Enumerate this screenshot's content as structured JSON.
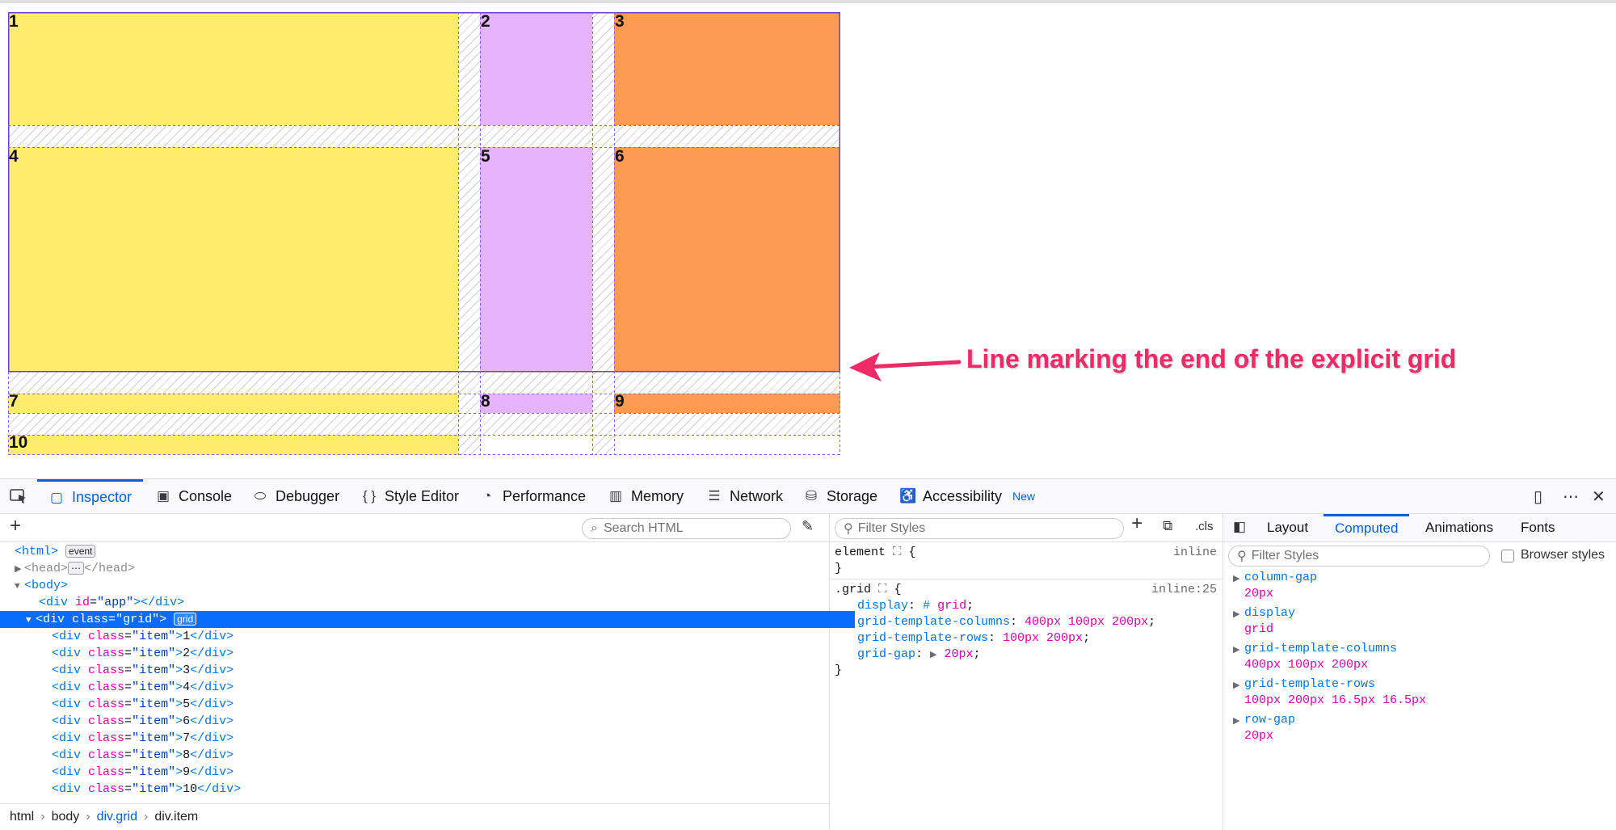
{
  "grid_items": [
    "1",
    "2",
    "3",
    "4",
    "5",
    "6",
    "7",
    "8",
    "9",
    "10"
  ],
  "annotation": "Line marking the end of the explicit grid",
  "toolbar": {
    "tabs": [
      {
        "label": "Inspector",
        "icon": "inspector-icon"
      },
      {
        "label": "Console",
        "icon": "console-icon"
      },
      {
        "label": "Debugger",
        "icon": "debugger-icon"
      },
      {
        "label": "Style Editor",
        "icon": "style-editor-icon"
      },
      {
        "label": "Performance",
        "icon": "performance-icon"
      },
      {
        "label": "Memory",
        "icon": "memory-icon"
      },
      {
        "label": "Network",
        "icon": "network-icon"
      },
      {
        "label": "Storage",
        "icon": "storage-icon"
      },
      {
        "label": "Accessibility",
        "icon": "accessibility-icon"
      }
    ],
    "new_badge": "New"
  },
  "markup": {
    "search_placeholder": "Search HTML",
    "html_open": "<html>",
    "event_badge": "event",
    "head_open": "<head>",
    "head_ellipsis": "⋯",
    "head_close": "</head>",
    "body_open": "<body>",
    "app_div": {
      "tag": "<div",
      "attr": "id",
      "val": "\"app\"",
      "end": "></div>"
    },
    "grid_div": {
      "tag": "<div",
      "attr": "class",
      "val": "\"grid\"",
      "end": ">"
    },
    "grid_badge": "grid",
    "items": [
      {
        "text": "1"
      },
      {
        "text": "2"
      },
      {
        "text": "3"
      },
      {
        "text": "4"
      },
      {
        "text": "5"
      },
      {
        "text": "6"
      },
      {
        "text": "7"
      },
      {
        "text": "8"
      },
      {
        "text": "9"
      },
      {
        "text": "10"
      }
    ],
    "item_tag": "<div",
    "item_attr": "class",
    "item_val": "\"item\"",
    "item_gt": ">",
    "item_close": "</div>"
  },
  "breadcrumbs": [
    "html",
    "body",
    "div.grid",
    "div.item"
  ],
  "rules": {
    "filter_placeholder": "Filter Styles",
    "cls_label": ".cls",
    "element_selector": "element",
    "element_source": "inline",
    "grid_selector": ".grid",
    "grid_source": "inline:25",
    "declarations": [
      {
        "prop": "display",
        "value": "grid"
      },
      {
        "prop": "grid-template-columns",
        "value": "400px 100px 200px"
      },
      {
        "prop": "grid-template-rows",
        "value": "100px 200px"
      },
      {
        "prop": "grid-gap",
        "value": "20px"
      }
    ]
  },
  "sidebar": {
    "tabs": [
      "Layout",
      "Computed",
      "Animations",
      "Fonts"
    ],
    "active_tab": "Computed",
    "filter_placeholder": "Filter Styles",
    "browser_styles_label": "Browser styles",
    "computed": [
      {
        "name": "column-gap",
        "value": "20px"
      },
      {
        "name": "display",
        "value": "grid"
      },
      {
        "name": "grid-template-columns",
        "value": "400px 100px 200px"
      },
      {
        "name": "grid-template-rows",
        "value": "100px 200px 16.5px 16.5px"
      },
      {
        "name": "row-gap",
        "value": "20px"
      }
    ]
  },
  "colors": {
    "yellow": "#ffeb6e",
    "purple": "#e6b4fb",
    "orange": "#fd9b55",
    "accent": "#0060df",
    "annotation": "#ee2a67"
  }
}
